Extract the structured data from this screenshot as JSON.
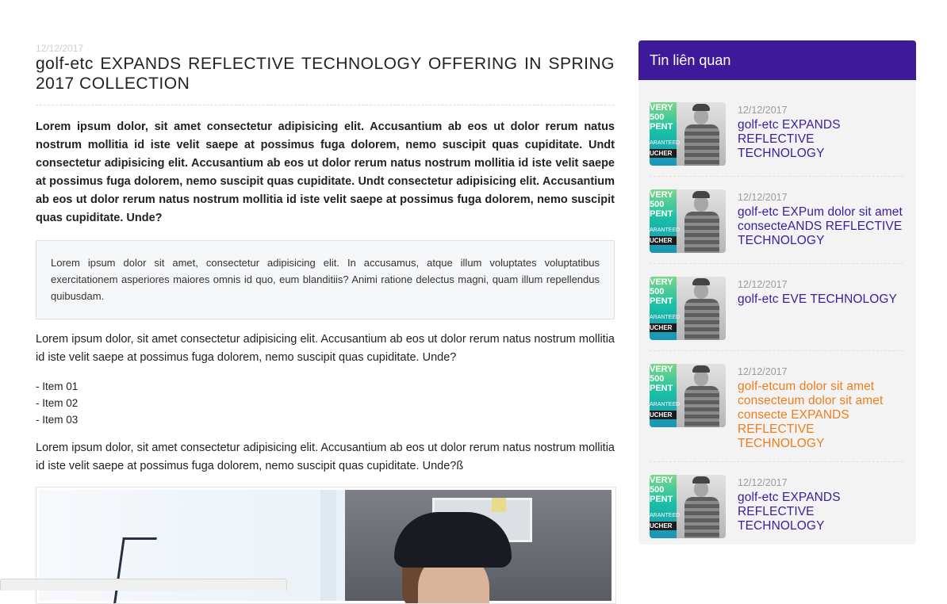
{
  "article": {
    "date": "12/12/2017",
    "title": "golf-etc EXPANDS REFLECTIVE TECHNOLOGY OFFERING IN SPRING 2017 COLLECTION",
    "lead": "Lorem ipsum dolor, sit amet consectetur adipisicing elit. Accusantium ab eos ut dolor rerum natus nostrum mollitia id iste velit saepe at possimus fuga dolorem, nemo suscipit quas cupiditate. Undt consectetur adipisicing elit. Accusantium ab eos ut dolor rerum natus nostrum mollitia id iste velit saepe at possimus fuga dolorem, nemo suscipit quas cupiditate. Undt consectetur adipisicing elit. Accusantium ab eos ut dolor rerum natus nostrum mollitia id iste velit saepe at possimus fuga dolorem, nemo suscipit quas cupiditate. Unde?",
    "quote": "Lorem ipsum dolor sit amet, consectetur adipisicing elit. In accusamus, atque illum voluptates voluptatibus exercitationem asperiores maiores omnis id quo, eum blanditiis? Animi ratione delectus magni, quam illum repellendus quibusdam.",
    "paragraph1": "Lorem ipsum dolor, sit amet consectetur adipisicing elit. Accusantium ab eos ut dolor rerum natus nostrum mollitia id iste velit saepe at possimus fuga dolorem, nemo suscipit quas cupiditate. Unde?",
    "items": [
      "- Item 01",
      "- Item 02",
      "- Item 03"
    ],
    "paragraph2": "Lorem ipsum dolor, sit amet consectetur adipisicing elit. Accusantium ab eos ut dolor rerum natus nostrum mollitia id iste velit saepe at possimus fuga dolorem, nemo suscipit quas cupiditate. Unde?ß"
  },
  "sidebar": {
    "heading": "Tin liên quan",
    "accent_color": "#3e1a9a",
    "active_color": "#f07d1c",
    "thumb_text": [
      "VERY",
      "500",
      "PENT",
      "ARANTEED",
      "UCHER"
    ],
    "items": [
      {
        "date": "12/12/2017",
        "title": "golf-etc EXPANDS REFLECTIVE TECHNOLOGY",
        "active": false
      },
      {
        "date": "12/12/2017",
        "title": "golf-etc EXPum dolor sit amet consecteANDS REFLECTIVE TECHNOLOGY",
        "active": false
      },
      {
        "date": "12/12/2017",
        "title": "golf-etc EVE TECHNOLOGY",
        "active": false
      },
      {
        "date": "12/12/2017",
        "title": "golf-etcum dolor sit amet consecteum dolor sit amet consecte EXPANDS REFLECTIVE TECHNOLOGY",
        "active": true
      },
      {
        "date": "12/12/2017",
        "title": "golf-etc EXPANDS REFLECTIVE TECHNOLOGY",
        "active": false
      }
    ]
  }
}
